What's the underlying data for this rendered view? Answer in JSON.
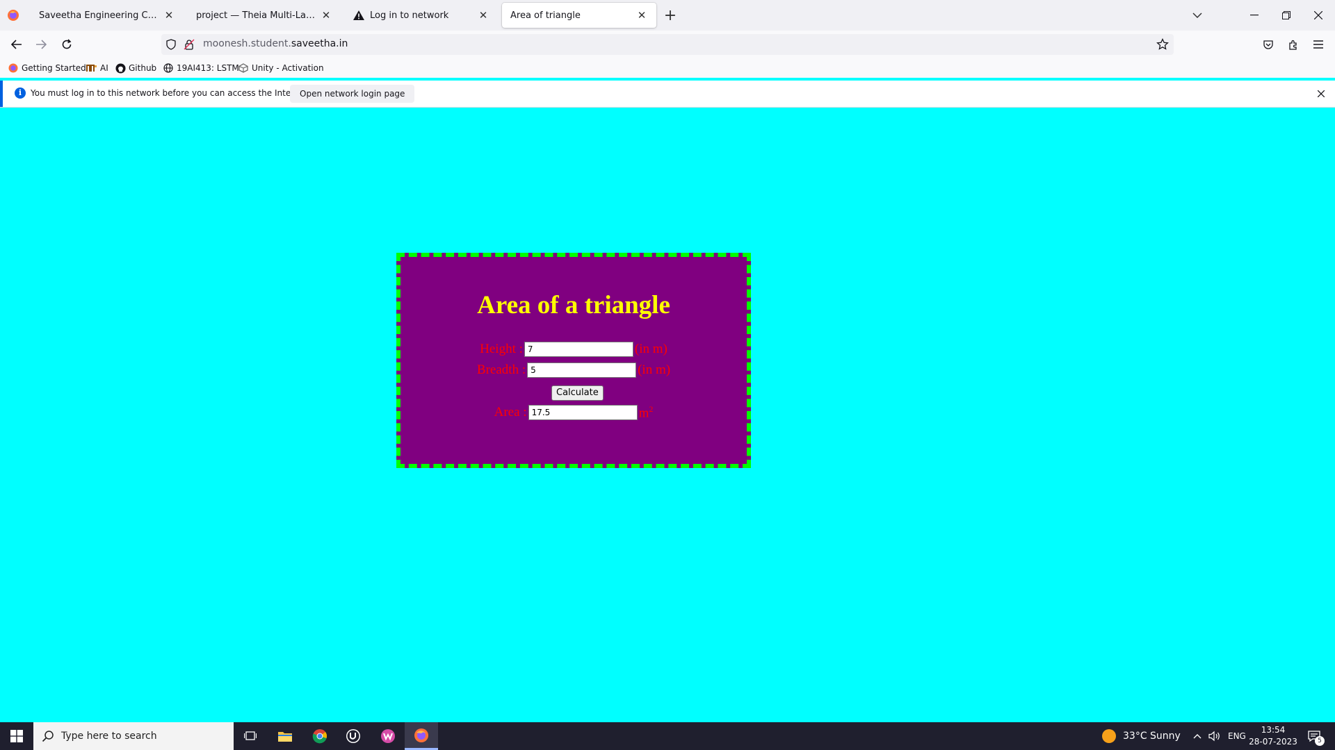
{
  "browser": {
    "tabs": [
      {
        "title": "Saveetha Engineering College",
        "active": false
      },
      {
        "title": "project — Theia Multi-Language Explorer",
        "active": false
      },
      {
        "title": "Log in to network",
        "active": false,
        "icon": "warning-icon"
      },
      {
        "title": "Area of triangle",
        "active": true
      }
    ],
    "url": {
      "prefix": "moonesh.student.",
      "domain": "saveetha.in"
    },
    "bookmarks": [
      {
        "label": "Getting Started",
        "icon": "firefox-icon"
      },
      {
        "label": "AI",
        "icon": "ai-icon"
      },
      {
        "label": "Github",
        "icon": "github-icon"
      },
      {
        "label": "19AI413: LSTM",
        "icon": "globe-icon"
      },
      {
        "label": "Unity - Activation",
        "icon": "unity-icon"
      }
    ],
    "notification": {
      "message": "You must log in to this network before you can access the Internet.",
      "button_label": "Open network login page"
    }
  },
  "page": {
    "background": "#00ffff",
    "box_background": "#800080",
    "box_border_color": "#00ff00",
    "title": "Area of a triangle",
    "height": {
      "label": "Height :",
      "value": "7",
      "unit": "(in m)"
    },
    "breadth": {
      "label": "Breadth :",
      "value": "5",
      "unit": "(in m)"
    },
    "calculate_label": "Calculate",
    "area": {
      "label": "Area :",
      "value": "17.5",
      "unit": "m",
      "unit_sup": "2"
    }
  },
  "taskbar": {
    "search_placeholder": "Type here to search",
    "weather": "33°C  Sunny",
    "language": "ENG",
    "time": "13:54",
    "date": "28-07-2023",
    "notification_count": "5"
  }
}
